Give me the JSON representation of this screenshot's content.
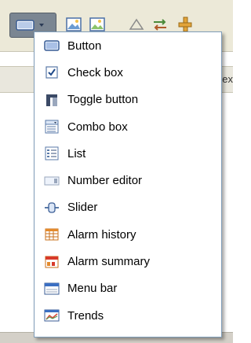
{
  "toolbar": {
    "strip_text": "ex"
  },
  "menu": {
    "items": [
      {
        "label": "Button",
        "icon": "button-widget-icon"
      },
      {
        "label": "Check box",
        "icon": "checkbox-icon"
      },
      {
        "label": "Toggle button",
        "icon": "toggle-button-icon"
      },
      {
        "label": "Combo box",
        "icon": "combo-box-icon"
      },
      {
        "label": "List",
        "icon": "list-icon"
      },
      {
        "label": "Number editor",
        "icon": "number-editor-icon"
      },
      {
        "label": "Slider",
        "icon": "slider-icon"
      },
      {
        "label": "Alarm history",
        "icon": "alarm-history-icon"
      },
      {
        "label": "Alarm summary",
        "icon": "alarm-summary-icon"
      },
      {
        "label": "Menu bar",
        "icon": "menu-bar-icon"
      },
      {
        "label": "Trends",
        "icon": "trends-icon"
      }
    ]
  },
  "colors": {
    "toolbar_bg": "#ece9d8",
    "menu_border": "#7f9db9",
    "active_button_bg": "#7b8692"
  }
}
